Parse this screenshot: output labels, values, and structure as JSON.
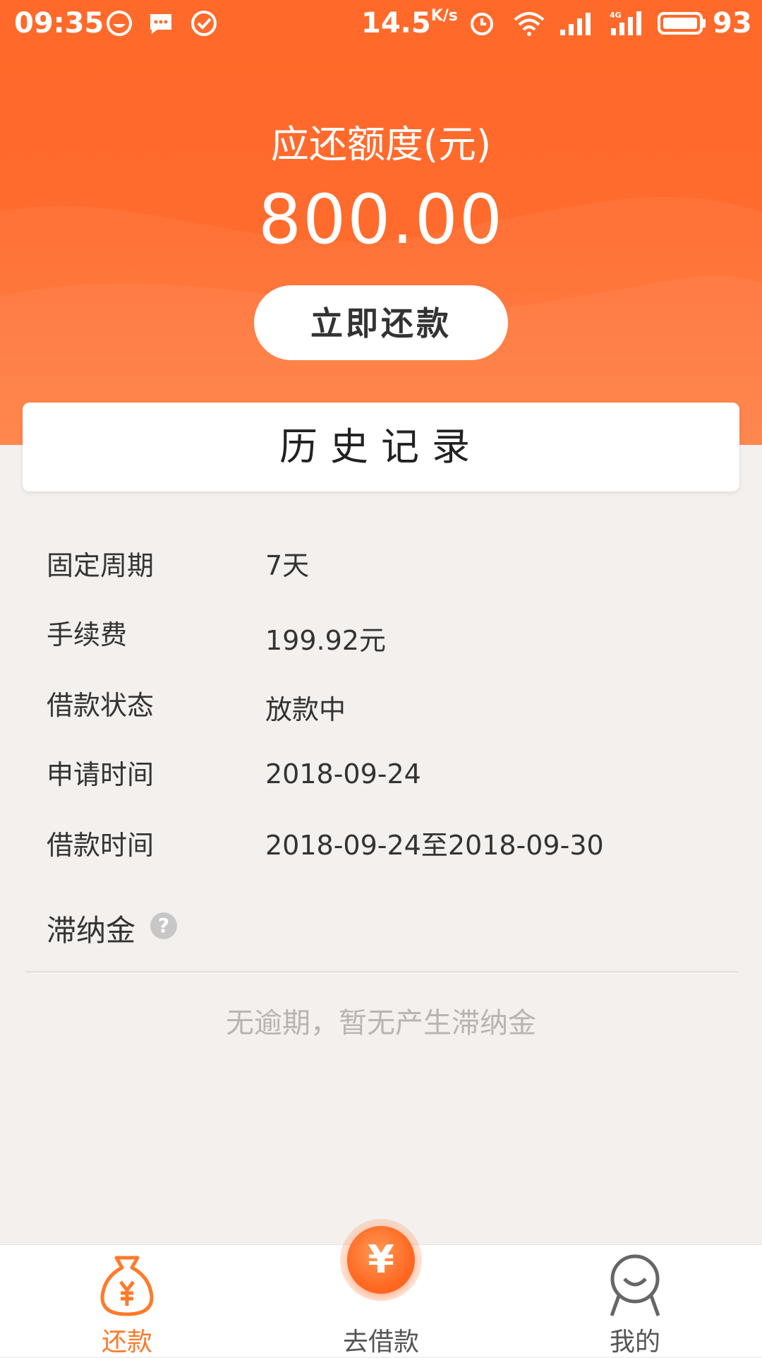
{
  "status_bar": {
    "time": "09:35",
    "speed": "14.5",
    "speed_unit": "K/s",
    "network": "4G",
    "battery": "93"
  },
  "header": {
    "amount_label": "应还额度(元)",
    "amount": "800.00",
    "repay_button": "立即还款"
  },
  "history_card": {
    "title": "历史记录"
  },
  "details": [
    {
      "label": "固定周期",
      "value": "7天"
    },
    {
      "label": "手续费",
      "value": "199.92元"
    },
    {
      "label": "借款状态",
      "value": "放款中"
    },
    {
      "label": "申请时间",
      "value": "2018-09-24"
    },
    {
      "label": "借款时间",
      "value": "2018-09-24至2018-09-30"
    }
  ],
  "late_fee": {
    "label": "滞纳金",
    "help_icon": "?",
    "message": "无逾期，暂无产生滞纳金"
  },
  "bottom_nav": {
    "items": [
      {
        "label": "还款",
        "icon": "money-bag-icon",
        "active": true
      },
      {
        "label": "去借款",
        "icon": "yuan-coin-icon",
        "active": false
      },
      {
        "label": "我的",
        "icon": "user-icon",
        "active": false
      }
    ],
    "center_symbol": "¥"
  },
  "colors": {
    "accent": "#ff6b2c",
    "active_nav": "#ff7a2a",
    "inactive_nav": "#555555"
  }
}
